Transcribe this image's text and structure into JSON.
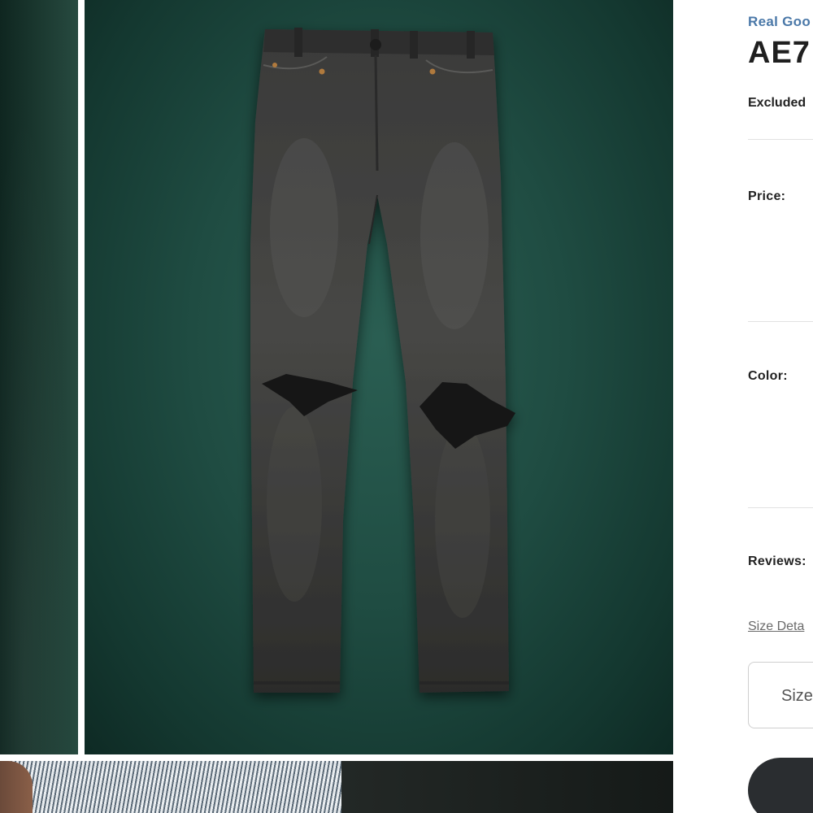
{
  "gallery": {
    "main_image_alt": "Black ripped jeans",
    "background_color": "#1f4c42"
  },
  "product": {
    "brand_link": "Real Goo",
    "title": "AE7",
    "excluded_text": "Excluded"
  },
  "rows": {
    "price_label": "Price:",
    "color_label": "Color:",
    "reviews_label": "Reviews:"
  },
  "size": {
    "details_link": "Size Deta",
    "select_placeholder": "Size"
  },
  "colors": {
    "brand_link": "#4a78a8",
    "button": "#2a2d30"
  }
}
